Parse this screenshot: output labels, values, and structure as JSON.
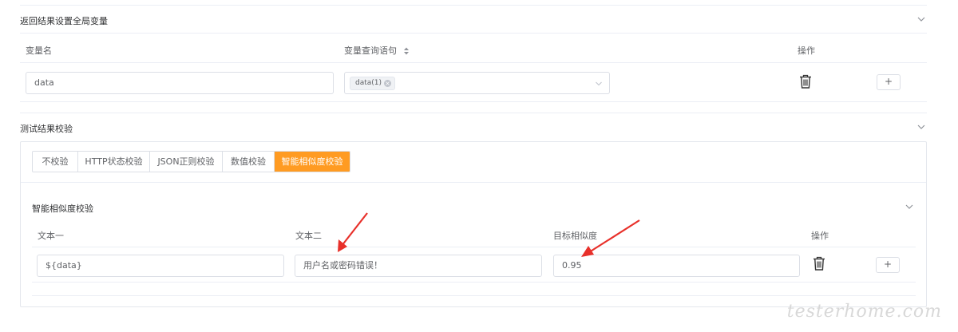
{
  "global_vars": {
    "title": "返回结果设置全局变量",
    "col_var_name": "变量名",
    "col_query": "变量查询语句",
    "col_action": "操作",
    "row": {
      "var_name": "data",
      "tag": "data(1)",
      "add_label": "+"
    }
  },
  "result_check": {
    "title": "测试结果校验",
    "tabs": [
      {
        "label": "不校验"
      },
      {
        "label": "HTTP状态校验"
      },
      {
        "label": "JSON正则校验"
      },
      {
        "label": "数值校验"
      },
      {
        "label": "智能相似度校验",
        "active": true
      }
    ],
    "similarity": {
      "title": "智能相似度校验",
      "col_text1": "文本一",
      "col_text2": "文本二",
      "col_target": "目标相似度",
      "col_action": "操作",
      "row": {
        "text1": "${data}",
        "text2": "用户名或密码错误！",
        "target": "0.95",
        "add_label": "+"
      }
    }
  },
  "watermark": "testerhome.com",
  "colors": {
    "accent": "#ff9b22",
    "annotation_arrow": "#e8302a"
  }
}
